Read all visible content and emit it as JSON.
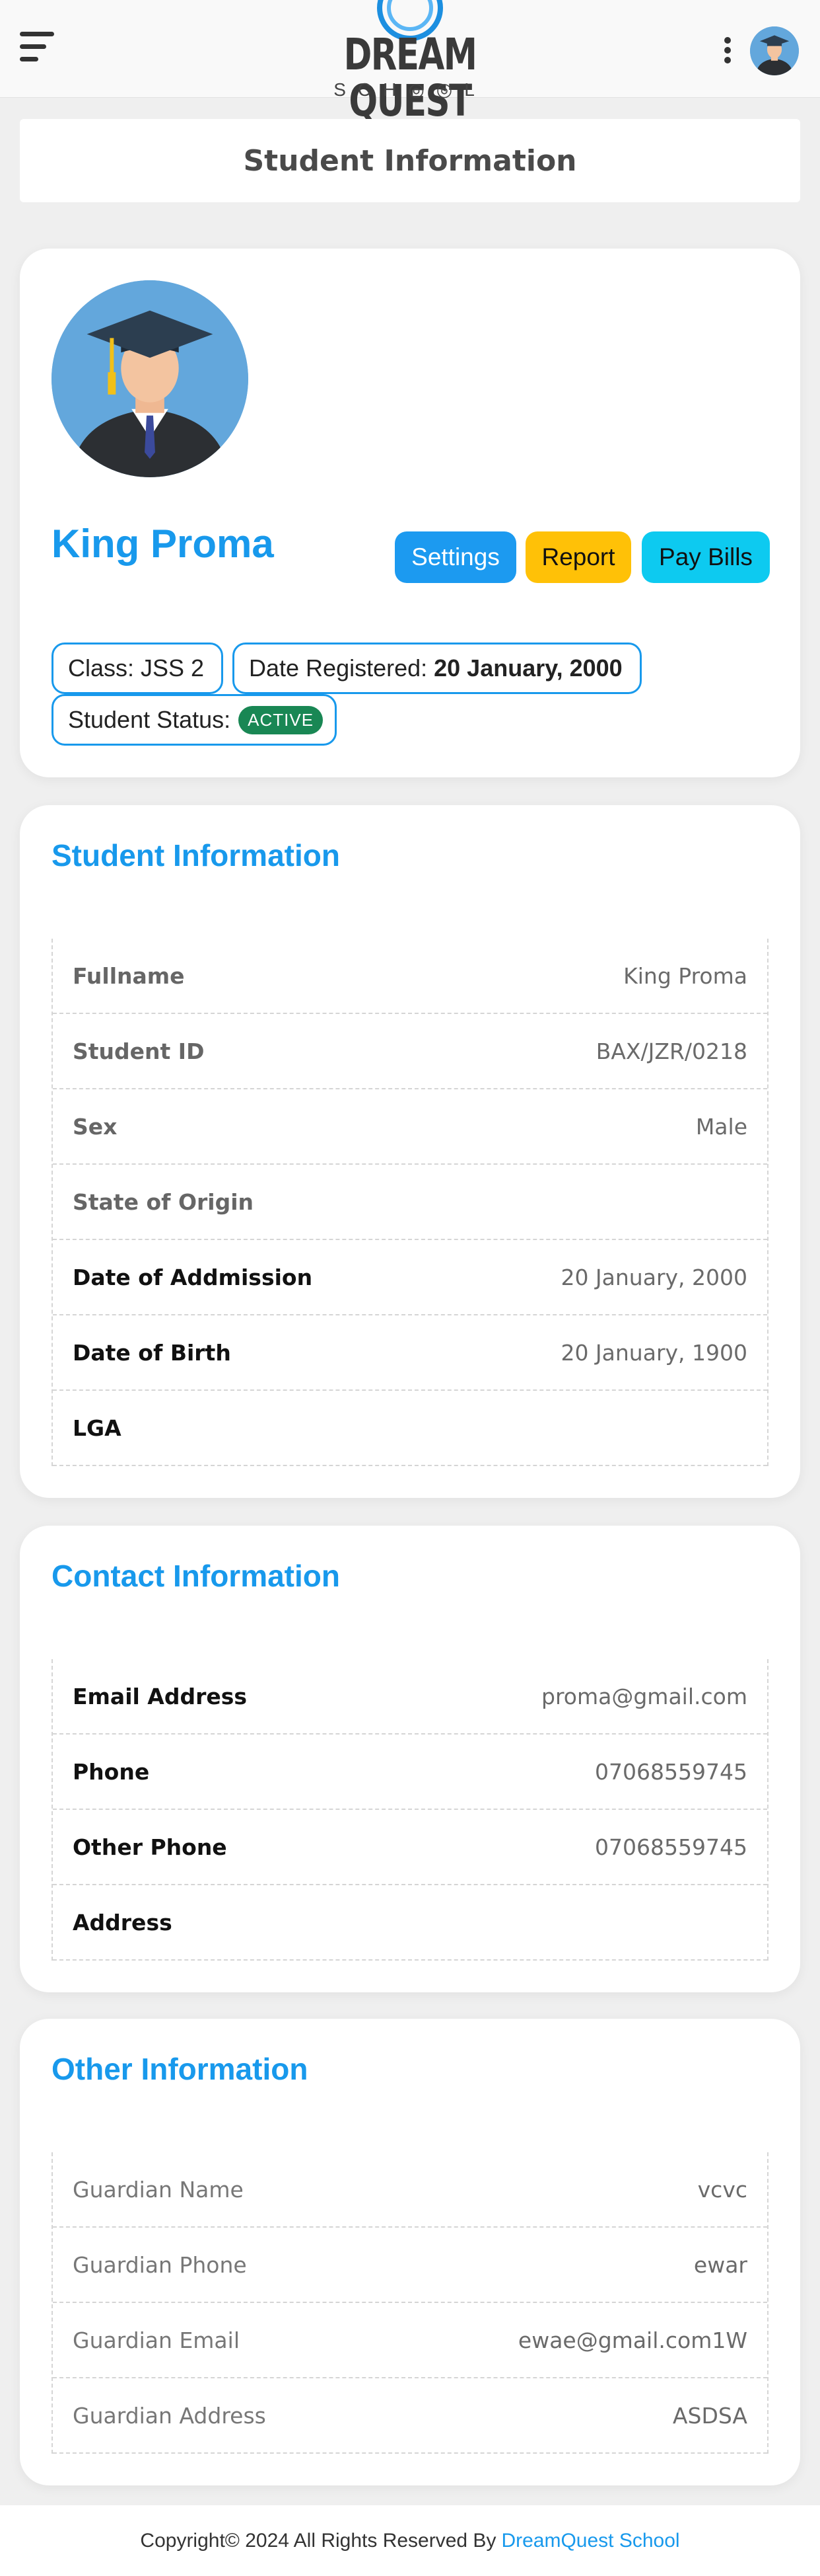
{
  "header": {
    "logo_title": "DREAM QUEST",
    "logo_subtitle": "SCH◎◎L"
  },
  "page_title": "Student Information",
  "profile": {
    "name": "King Proma",
    "buttons": {
      "settings": "Settings",
      "report": "Report",
      "pay_bills": "Pay Bills"
    },
    "class_label": "Class: JSS 2",
    "date_registered_label": "Date Registered:",
    "date_registered_value": "20 January, 2000",
    "status_label": "Student Status:",
    "status_value": "ACTIVE"
  },
  "student_info": {
    "title": "Student Information",
    "rows": [
      {
        "key": "Fullname",
        "value": "King Proma"
      },
      {
        "key": "Student ID",
        "value": "BAX/JZR/0218"
      },
      {
        "key": "Sex",
        "value": "Male"
      },
      {
        "key": "State of Origin",
        "value": ""
      },
      {
        "key": "Date of Addmission",
        "value": "20 January, 2000"
      },
      {
        "key": "Date of Birth",
        "value": "20 January, 1900"
      },
      {
        "key": "LGA",
        "value": ""
      }
    ]
  },
  "contact_info": {
    "title": "Contact Information",
    "rows": [
      {
        "key": "Email Address",
        "value": "proma@gmail.com"
      },
      {
        "key": "Phone",
        "value": "07068559745"
      },
      {
        "key": "Other Phone",
        "value": "07068559745"
      },
      {
        "key": "Address",
        "value": ""
      }
    ]
  },
  "other_info": {
    "title": "Other Information",
    "rows": [
      {
        "key": "Guardian Name",
        "value": "vcvc"
      },
      {
        "key": "Guardian Phone",
        "value": "ewar"
      },
      {
        "key": "Guardian Email",
        "value": "ewae@gmail.com1W"
      },
      {
        "key": "Guardian Address",
        "value": "ASDSA"
      }
    ]
  },
  "footer": {
    "text": "Copyright© 2024 All Rights Reserved By",
    "link": "DreamQuest School"
  },
  "colors": {
    "accent": "#1899ec",
    "report": "#ffc107",
    "pay_bills": "#0dcaf0",
    "active": "#198754"
  }
}
